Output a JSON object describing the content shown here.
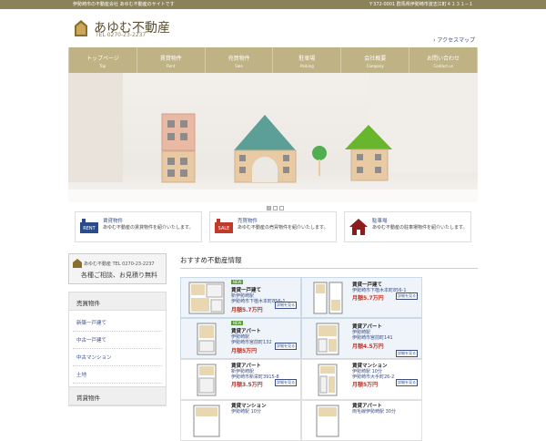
{
  "topbar": {
    "tagline": "伊勢崎市の不動産会社 あゆむ不動産のサイトです",
    "address": "〒372-0001 群馬県伊勢崎市波志江町４１３１−１"
  },
  "header": {
    "company_name": "あゆむ不動産",
    "tel": "TEL 0270-23-2237",
    "access_link": "› アクセスマップ"
  },
  "nav": [
    {
      "jp": "トップページ",
      "en": "Top"
    },
    {
      "jp": "賃貸物件",
      "en": "Rent"
    },
    {
      "jp": "売買物件",
      "en": "Sale"
    },
    {
      "jp": "駐車場",
      "en": "Parking"
    },
    {
      "jp": "会社概要",
      "en": "Company"
    },
    {
      "jp": "お問い合わせ",
      "en": "Contact us"
    }
  ],
  "cards": [
    {
      "title": "賃貸物件",
      "desc": "あゆむ不動産の賃貸物件を紹介いたします。",
      "icon_text": "FOR RENT",
      "color": "#2b4c8c"
    },
    {
      "title": "売買物件",
      "desc": "あゆむ不動産の売買物件を紹介いたします。",
      "icon_text": "FOR SALE",
      "color": "#c0392b"
    },
    {
      "title": "駐車場",
      "desc": "あゆむ不動産の駐車場物件を紹介いたします。",
      "icon_text": "",
      "color": "#8e1b1b"
    }
  ],
  "sidebar": {
    "tel_line": "あゆむ不動産 TEL 0270-23-2237",
    "consult_line": "各種ご相談、お見積り無料",
    "sale_title": "売買物件",
    "sale_items": [
      "新築一戸建て",
      "中古一戸建て",
      "中古マンション",
      "土地"
    ],
    "rent_title": "賃貸物件"
  },
  "recommend": {
    "title": "おすすめ不動産情報",
    "detail_label": "詳細を見る",
    "new_label": "NEW",
    "listings": [
      {
        "type": "賃貸一戸建て",
        "station": "新伊勢崎駅",
        "address": "伊勢崎市下植木本町856-1",
        "price": "月額5.7万円",
        "new": true,
        "highlight": true
      },
      {
        "type": "賃貸一戸建て",
        "station": "",
        "address": "伊勢崎市下植木本町856-1",
        "price": "月額5.7万円",
        "new": false,
        "highlight": true
      },
      {
        "type": "賃貸アパート",
        "station": "伊勢崎駅",
        "address": "伊勢崎市宮前町132",
        "price": "月額5万円",
        "new": true,
        "highlight": true
      },
      {
        "type": "賃貸アパート",
        "station": "伊勢崎駅",
        "address": "伊勢崎市宮前町141",
        "price": "月額4.5万円",
        "new": false,
        "highlight": true
      },
      {
        "type": "賃貸アパート",
        "station": "新伊勢崎駅",
        "address": "伊勢崎市新栄町3915-8",
        "price": "月額3.5万円",
        "new": false,
        "highlight": false
      },
      {
        "type": "賃貸マンション",
        "station": "伊勢崎駅 10分",
        "address": "伊勢崎市大手町26-2",
        "price": "月額5万円",
        "new": false,
        "highlight": false
      },
      {
        "type": "賃貸マンション",
        "station": "伊勢崎駅 10分",
        "address": "",
        "price": "",
        "new": false,
        "highlight": false
      },
      {
        "type": "賃貸アパート",
        "station": "両毛線伊勢崎駅 30分",
        "address": "",
        "price": "",
        "new": false,
        "highlight": false
      }
    ]
  }
}
